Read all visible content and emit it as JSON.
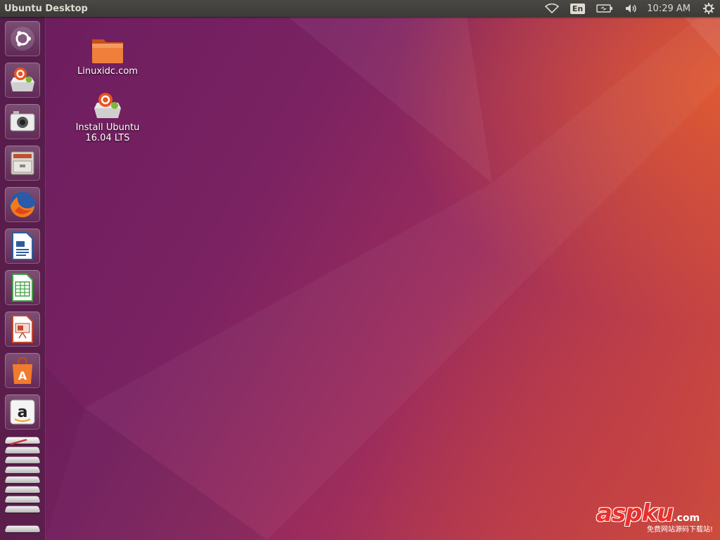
{
  "topbar": {
    "title": "Ubuntu Desktop",
    "indicators": {
      "network_icon": "wifi-icon",
      "keyboard_layout": "En",
      "battery_icon": "battery-icon",
      "volume_icon": "volume-icon",
      "clock": "10:29 AM",
      "session_icon": "gear-icon"
    }
  },
  "launcher": {
    "items": [
      {
        "name": "Dash Home",
        "icon": "ubuntu-logo-icon"
      },
      {
        "name": "Install Ubuntu 16.04 LTS",
        "icon": "install-ubuntu-icon"
      },
      {
        "name": "Camera",
        "icon": "camera-icon"
      },
      {
        "name": "Files",
        "icon": "file-cabinet-icon"
      },
      {
        "name": "Firefox Web Browser",
        "icon": "firefox-icon"
      },
      {
        "name": "LibreOffice Writer",
        "icon": "writer-icon"
      },
      {
        "name": "LibreOffice Calc",
        "icon": "calc-icon"
      },
      {
        "name": "LibreOffice Impress",
        "icon": "impress-icon"
      },
      {
        "name": "Ubuntu Software",
        "icon": "software-bag-icon"
      },
      {
        "name": "Amazon",
        "icon": "amazon-icon"
      }
    ]
  },
  "desktop": {
    "icons": [
      {
        "label": "Linuxidc.com",
        "icon": "folder-icon"
      },
      {
        "label": "Install Ubuntu\n16.04 LTS",
        "icon": "install-ubuntu-icon"
      }
    ]
  },
  "watermark": {
    "brand": "aspku",
    "domain": ".com",
    "tagline": "免费网站源码下载站!"
  },
  "colors": {
    "panel": "#3c3b37",
    "panel_text": "#dfdbd2",
    "accent_orange": "#e95420",
    "aubergine": "#77216f",
    "watermark_red": "#e8312b"
  }
}
